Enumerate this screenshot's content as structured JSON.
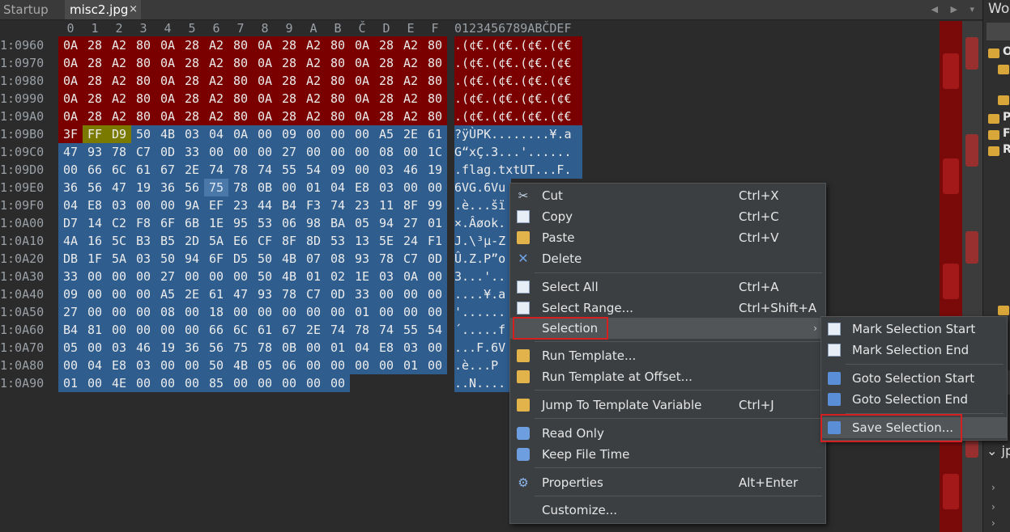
{
  "tabs": {
    "startup": "Startup",
    "active": "misc2.jpg",
    "close": "×",
    "nav": "◀ ▶ ▾"
  },
  "right_panel": {
    "title": "Wo",
    "items": [
      "O",
      "P",
      "F",
      "R"
    ],
    "jp": "jp"
  },
  "hex": {
    "col_headers": [
      "0",
      "1",
      "2",
      "3",
      "4",
      "5",
      "6",
      "7",
      "8",
      "9",
      "A",
      "B",
      "Č",
      "D",
      "E",
      "F"
    ],
    "ascii_header": "0123456789ABČDEF",
    "rows": [
      {
        "addr": "1:0960",
        "bytes": [
          "0A",
          "28",
          "A2",
          "80",
          "0A",
          "28",
          "A2",
          "80",
          "0A",
          "28",
          "A2",
          "80",
          "0A",
          "28",
          "A2",
          "80"
        ],
        "ascii": ".(¢€.(¢€.(¢€.(¢€"
      },
      {
        "addr": "1:0970",
        "bytes": [
          "0A",
          "28",
          "A2",
          "80",
          "0A",
          "28",
          "A2",
          "80",
          "0A",
          "28",
          "A2",
          "80",
          "0A",
          "28",
          "A2",
          "80"
        ],
        "ascii": ".(¢€.(¢€.(¢€.(¢€"
      },
      {
        "addr": "1:0980",
        "bytes": [
          "0A",
          "28",
          "A2",
          "80",
          "0A",
          "28",
          "A2",
          "80",
          "0A",
          "28",
          "A2",
          "80",
          "0A",
          "28",
          "A2",
          "80"
        ],
        "ascii": ".(¢€.(¢€.(¢€.(¢€"
      },
      {
        "addr": "1:0990",
        "bytes": [
          "0A",
          "28",
          "A2",
          "80",
          "0A",
          "28",
          "A2",
          "80",
          "0A",
          "28",
          "A2",
          "80",
          "0A",
          "28",
          "A2",
          "80"
        ],
        "ascii": ".(¢€.(¢€.(¢€.(¢€"
      },
      {
        "addr": "1:09A0",
        "bytes": [
          "0A",
          "28",
          "A2",
          "80",
          "0A",
          "28",
          "A2",
          "80",
          "0A",
          "28",
          "A2",
          "80",
          "0A",
          "28",
          "A2",
          "80"
        ],
        "ascii": ".(¢€.(¢€.(¢€.(¢€"
      },
      {
        "addr": "1:09B0",
        "bytes": [
          "3F",
          "FF",
          "D9",
          "50",
          "4B",
          "03",
          "04",
          "0A",
          "00",
          "09",
          "00",
          "00",
          "00",
          "A5",
          "2E",
          "61"
        ],
        "ascii": "?ÿÙPK........¥.a"
      },
      {
        "addr": "1:09C0",
        "bytes": [
          "47",
          "93",
          "78",
          "C7",
          "0D",
          "33",
          "00",
          "00",
          "00",
          "27",
          "00",
          "00",
          "00",
          "08",
          "00",
          "1C"
        ],
        "ascii": "G“xÇ.3...'......"
      },
      {
        "addr": "1:09D0",
        "bytes": [
          "00",
          "66",
          "6C",
          "61",
          "67",
          "2E",
          "74",
          "78",
          "74",
          "55",
          "54",
          "09",
          "00",
          "03",
          "46",
          "19"
        ],
        "ascii": ".flag.txtUT...F."
      },
      {
        "addr": "1:09E0",
        "bytes": [
          "36",
          "56",
          "47",
          "19",
          "36",
          "56",
          "75",
          "78",
          "0B",
          "00",
          "01",
          "04",
          "E8",
          "03",
          "00",
          "00"
        ],
        "ascii": "6VG.6Vu"
      },
      {
        "addr": "1:09F0",
        "bytes": [
          "04",
          "E8",
          "03",
          "00",
          "00",
          "9A",
          "EF",
          "23",
          "44",
          "B4",
          "F3",
          "74",
          "23",
          "11",
          "8F",
          "99"
        ],
        "ascii": ".è...šï"
      },
      {
        "addr": "1:0A00",
        "bytes": [
          "D7",
          "14",
          "C2",
          "F8",
          "6F",
          "6B",
          "1E",
          "95",
          "53",
          "06",
          "98",
          "BA",
          "05",
          "94",
          "27",
          "01"
        ],
        "ascii": "×.Âøok."
      },
      {
        "addr": "1:0A10",
        "bytes": [
          "4A",
          "16",
          "5C",
          "B3",
          "B5",
          "2D",
          "5A",
          "E6",
          "CF",
          "8F",
          "8D",
          "53",
          "13",
          "5E",
          "24",
          "F1"
        ],
        "ascii": "J.\\³µ-Z"
      },
      {
        "addr": "1:0A20",
        "bytes": [
          "DB",
          "1F",
          "5A",
          "03",
          "50",
          "94",
          "6F",
          "D5",
          "50",
          "4B",
          "07",
          "08",
          "93",
          "78",
          "C7",
          "0D"
        ],
        "ascii": "Û.Z.P”o"
      },
      {
        "addr": "1:0A30",
        "bytes": [
          "33",
          "00",
          "00",
          "00",
          "27",
          "00",
          "00",
          "00",
          "50",
          "4B",
          "01",
          "02",
          "1E",
          "03",
          "0A",
          "00"
        ],
        "ascii": "3...'.."
      },
      {
        "addr": "1:0A40",
        "bytes": [
          "09",
          "00",
          "00",
          "00",
          "A5",
          "2E",
          "61",
          "47",
          "93",
          "78",
          "C7",
          "0D",
          "33",
          "00",
          "00",
          "00"
        ],
        "ascii": "....¥.a"
      },
      {
        "addr": "1:0A50",
        "bytes": [
          "27",
          "00",
          "00",
          "00",
          "08",
          "00",
          "18",
          "00",
          "00",
          "00",
          "00",
          "00",
          "01",
          "00",
          "00",
          "00"
        ],
        "ascii": "'......"
      },
      {
        "addr": "1:0A60",
        "bytes": [
          "B4",
          "81",
          "00",
          "00",
          "00",
          "00",
          "66",
          "6C",
          "61",
          "67",
          "2E",
          "74",
          "78",
          "74",
          "55",
          "54"
        ],
        "ascii": "´.....f"
      },
      {
        "addr": "1:0A70",
        "bytes": [
          "05",
          "00",
          "03",
          "46",
          "19",
          "36",
          "56",
          "75",
          "78",
          "0B",
          "00",
          "01",
          "04",
          "E8",
          "03",
          "00"
        ],
        "ascii": "...F.6V"
      },
      {
        "addr": "1:0A80",
        "bytes": [
          "00",
          "04",
          "E8",
          "03",
          "00",
          "00",
          "50",
          "4B",
          "05",
          "06",
          "00",
          "00",
          "00",
          "00",
          "01",
          "00"
        ],
        "ascii": ".è...P"
      },
      {
        "addr": "1:0A90",
        "bytes": [
          "01",
          "00",
          "4E",
          "00",
          "00",
          "00",
          "85",
          "00",
          "00",
          "00",
          "00",
          "00",
          "",
          "",
          "",
          ""
        ],
        "ascii": "..N...."
      }
    ]
  },
  "context_menu": {
    "items": [
      {
        "icon": "cut-icon",
        "label": "Cut",
        "shortcut": "Ctrl+X"
      },
      {
        "icon": "copy-icon",
        "label": "Copy",
        "shortcut": "Ctrl+C"
      },
      {
        "icon": "paste-icon",
        "label": "Paste",
        "shortcut": "Ctrl+V"
      },
      {
        "icon": "delete-icon",
        "label": "Delete",
        "shortcut": ""
      },
      {
        "icon": "select-all-icon",
        "label": "Select All",
        "shortcut": "Ctrl+A"
      },
      {
        "icon": "select-range-icon",
        "label": "Select Range...",
        "shortcut": "Ctrl+Shift+A"
      },
      {
        "icon": "",
        "label": "Selection",
        "shortcut": "",
        "arrow": "›"
      },
      {
        "icon": "run-template-icon",
        "label": "Run Template...",
        "shortcut": ""
      },
      {
        "icon": "run-template-offset-icon",
        "label": "Run Template at Offset...",
        "shortcut": ""
      },
      {
        "icon": "jump-template-icon",
        "label": "Jump To Template Variable",
        "shortcut": "Ctrl+J"
      },
      {
        "icon": "lock-icon",
        "label": "Read Only",
        "shortcut": ""
      },
      {
        "icon": "clock-icon",
        "label": "Keep File Time",
        "shortcut": ""
      },
      {
        "icon": "properties-icon",
        "label": "Properties",
        "shortcut": "Alt+Enter"
      },
      {
        "icon": "",
        "label": "Customize...",
        "shortcut": ""
      }
    ]
  },
  "submenu": {
    "items": [
      {
        "icon": "mark-start-icon",
        "label": "Mark Selection Start"
      },
      {
        "icon": "mark-end-icon",
        "label": "Mark Selection End"
      },
      {
        "icon": "goto-start-icon",
        "label": "Goto Selection Start"
      },
      {
        "icon": "goto-end-icon",
        "label": "Goto Selection End"
      },
      {
        "icon": "save-selection-icon",
        "label": "Save Selection..."
      }
    ]
  },
  "colors": {
    "red_bytes": "#7a0000",
    "selected_bytes": "#2e5d8e",
    "highlight_bytes": "#7a7a00",
    "annotation": "#d42020"
  }
}
